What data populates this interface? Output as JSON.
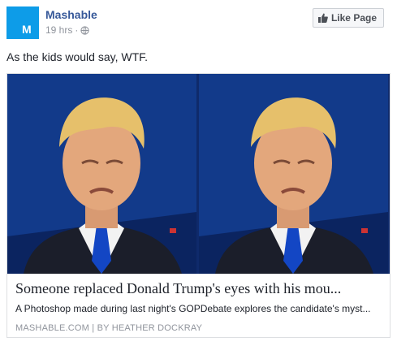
{
  "post": {
    "page_name": "Mashable",
    "avatar_letter": "M",
    "timestamp": "19 hrs",
    "separator": "·",
    "privacy_icon": "globe-icon",
    "like_button": "Like Page",
    "like_icon": "thumbs-up-icon",
    "text": "As the kids would say, WTF."
  },
  "link": {
    "title": "Someone replaced Donald Trump's eyes with his mou...",
    "description": "A Photoshop made during last night's GOPDebate explores the candidate's myst...",
    "source": "MASHABLE.COM",
    "divider": "|",
    "author": "BY HEATHER DOCKRAY"
  },
  "colors": {
    "brand_blue": "#365899",
    "avatar_blue": "#0d9ce8",
    "muted": "#90949c",
    "image_bg": "#0f2a6b"
  }
}
